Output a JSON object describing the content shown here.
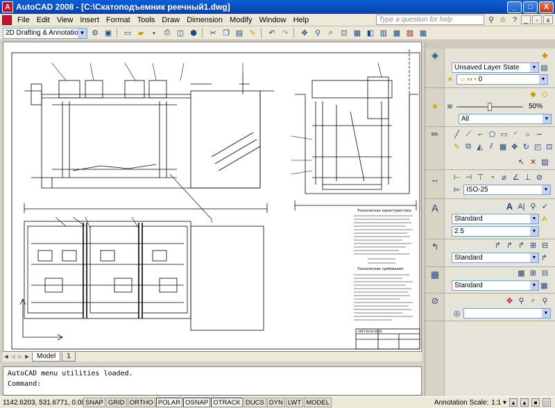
{
  "window": {
    "app_initial": "A",
    "title": "AutoCAD 2008 - [C:\\Скатоподъемник реечный1.dwg]",
    "controls": {
      "minimize": "_",
      "maximize": "□",
      "close": "X"
    }
  },
  "menu": {
    "items": [
      "File",
      "Edit",
      "View",
      "Insert",
      "Format",
      "Tools",
      "Draw",
      "Dimension",
      "Modify",
      "Window",
      "Help"
    ],
    "help_placeholder": "Type a question for help",
    "doc_controls": [
      "_",
      "▫",
      "x"
    ]
  },
  "toolbar": {
    "workspace": "2D Drafting & Annotation"
  },
  "tabs": {
    "items": [
      "Model",
      "1"
    ]
  },
  "command": {
    "lines": [
      "AutoCAD menu utilities loaded.",
      "Command:"
    ]
  },
  "status": {
    "coords": "1142.6203, 531.6771, 0.0000",
    "toggles": [
      "SNAP",
      "GRID",
      "ORTHO",
      "POLAR",
      "OSNAP",
      "OTRACK",
      "DUCS",
      "DYN",
      "LWT",
      "MODEL"
    ],
    "annotation_label": "Annotation Scale:",
    "annotation_value": "1:1 ▾"
  },
  "dashboard": {
    "layer_state": "Unsaved Layer State",
    "layer_value": "0",
    "fade_value": "50%",
    "filter_value": "All",
    "dim_style": "ISO-25",
    "text_style": "Standard",
    "text_height": "2.5",
    "multileader_style": "Standard",
    "table_style": "Standard"
  },
  "drawing": {
    "tech_title": "Техническая характеристика",
    "req_title": "Технические требования",
    "doc_number": "АКЕ748.00.00.00"
  }
}
